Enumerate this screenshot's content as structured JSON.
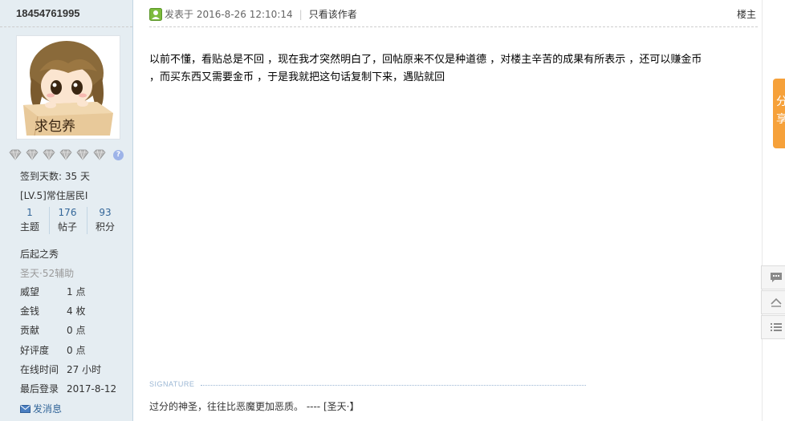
{
  "profile": {
    "username": "18454761995",
    "avatar_text": "求包养",
    "signin_days": "签到天数: 35 天",
    "level": "[LV.5]常住居民I",
    "stats": [
      {
        "value": "1",
        "label": "主题"
      },
      {
        "value": "176",
        "label": "帖子"
      },
      {
        "value": "93",
        "label": "积分"
      }
    ],
    "group": "后起之秀",
    "subgroup": "圣天·52辅助",
    "fields": [
      {
        "key": "威望",
        "value": "1 点"
      },
      {
        "key": "金钱",
        "value": "4 枚"
      },
      {
        "key": "贡献",
        "value": "0 点"
      },
      {
        "key": "好评度",
        "value": "0 点"
      },
      {
        "key": "在线时间",
        "value": "27 小时"
      },
      {
        "key": "最后登录",
        "value": "2017-8-12"
      }
    ],
    "send_message": "发消息",
    "help_badge": "?"
  },
  "post": {
    "posted_at": "发表于 2016-8-26 12:10:14",
    "only_author": "只看该作者",
    "floor": "楼主",
    "body_line1": "以前不懂，看贴总是不回 ，现在我才突然明白了，回帖原来不仅是种道德 ，对楼主辛苦的成果有所表示 ，还可以赚金币",
    "body_line2": "，而买东西又需要金币 ，于是我就把这句话复制下来，遇贴就回",
    "signature_label": "SIGNATURE",
    "signature": "过分的神圣，往往比恶魔更加恶质。 ---- [圣天·】"
  },
  "side_tools": {
    "share": "分享"
  },
  "colors": {
    "sidebar_bg": "#e5edf2",
    "link": "#336699",
    "share_tab": "#f6a13a"
  },
  "icons": [
    "gem-icon",
    "help-icon",
    "online-status-icon",
    "mail-icon",
    "comment-icon",
    "top-icon",
    "list-icon"
  ]
}
